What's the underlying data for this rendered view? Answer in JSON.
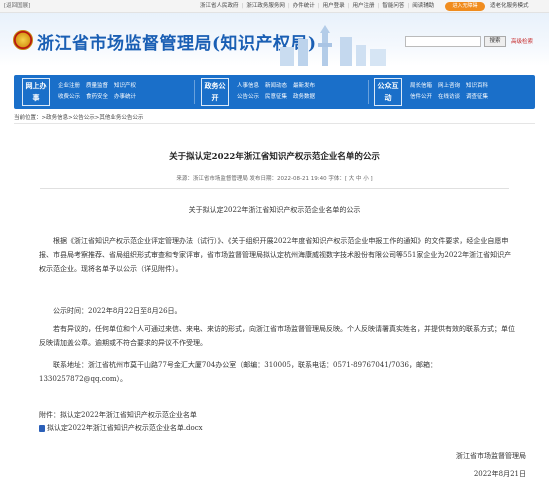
{
  "topbar": {
    "back_link": "[返回国展]",
    "links": [
      "浙江省人民政府",
      "浙江政务服务网",
      "办件统计",
      "用户登录",
      "用户注册",
      "智能问答",
      "阅读辅助"
    ],
    "enter_button": "进入无障碍",
    "elder_mode": "适老化服务模式"
  },
  "header": {
    "title": "浙江省市场监督管理局(知识产权局)",
    "search_placeholder": "",
    "search_button": "搜索",
    "advanced_search": "高级检索"
  },
  "nav": {
    "blocks": [
      {
        "label": "网上办事",
        "items": [
          "企业注册",
          "质量监督",
          "知识产权",
          "收费公示",
          "食药安全",
          "办事统计"
        ]
      },
      {
        "label": "政务公开",
        "items": [
          "人事信息",
          "新闻动态",
          "最新发布",
          "公告公示",
          "民意征集",
          "政务数据"
        ]
      },
      {
        "label": "公众互动",
        "items": [
          "局长信箱",
          "网上咨询",
          "知识百科",
          "信件公开",
          "在线访谈",
          "调查征集"
        ]
      }
    ]
  },
  "breadcrumb": "当前位置：>政务信息>公告公示>其他业务公告公示",
  "article": {
    "title": "关于拟认定2022年浙江省知识产权示范企业名单的公示",
    "meta": "来源：浙江省市场监督管理局  发布日期：2022-08-21 19:40  字体：[ 大  中  小 ]",
    "subtitle": "关于拟认定2022年浙江省知识产权示范企业名单的公示",
    "paragraph1": "根据《浙江省知识产权示范企业评定管理办法（试行）》、《关于组织开展2022年度省知识产权示范企业申报工作的通知》的文件要求，经企业自愿申报、市县局考察推荐、省局组织形式审查和专家评审，省市场监督管理局拟认定杭州海康威视数字技术股份有限公司等551家企业为2022年浙江省知识产权示范企业。现将名单予以公示（详见附件）。",
    "paragraph2": "公示时间：2022年8月22日至8月26日。",
    "paragraph3": "若有异议的，任何单位和个人可通过来信、来电、来访的形式，向浙江省市场监督管理局反映。个人反映请署真实姓名，并提供有效的联系方式；单位反映请加盖公章。逾期或不符合要求的异议不作受理。",
    "paragraph4": "联系地址：浙江省杭州市莫干山路77号金汇大厦704办公室（邮编：310005，联系电话：0571-89767041/7036，邮箱：1330257872@qq.com）。",
    "attachment_label": "附件：拟认定2022年浙江省知识产权示范企业名单",
    "attachment_file": "拟认定2022年浙江省知识产权示范企业名单.docx",
    "sign_org": "浙江省市场监督管理局",
    "sign_date": "2022年8月21日"
  }
}
